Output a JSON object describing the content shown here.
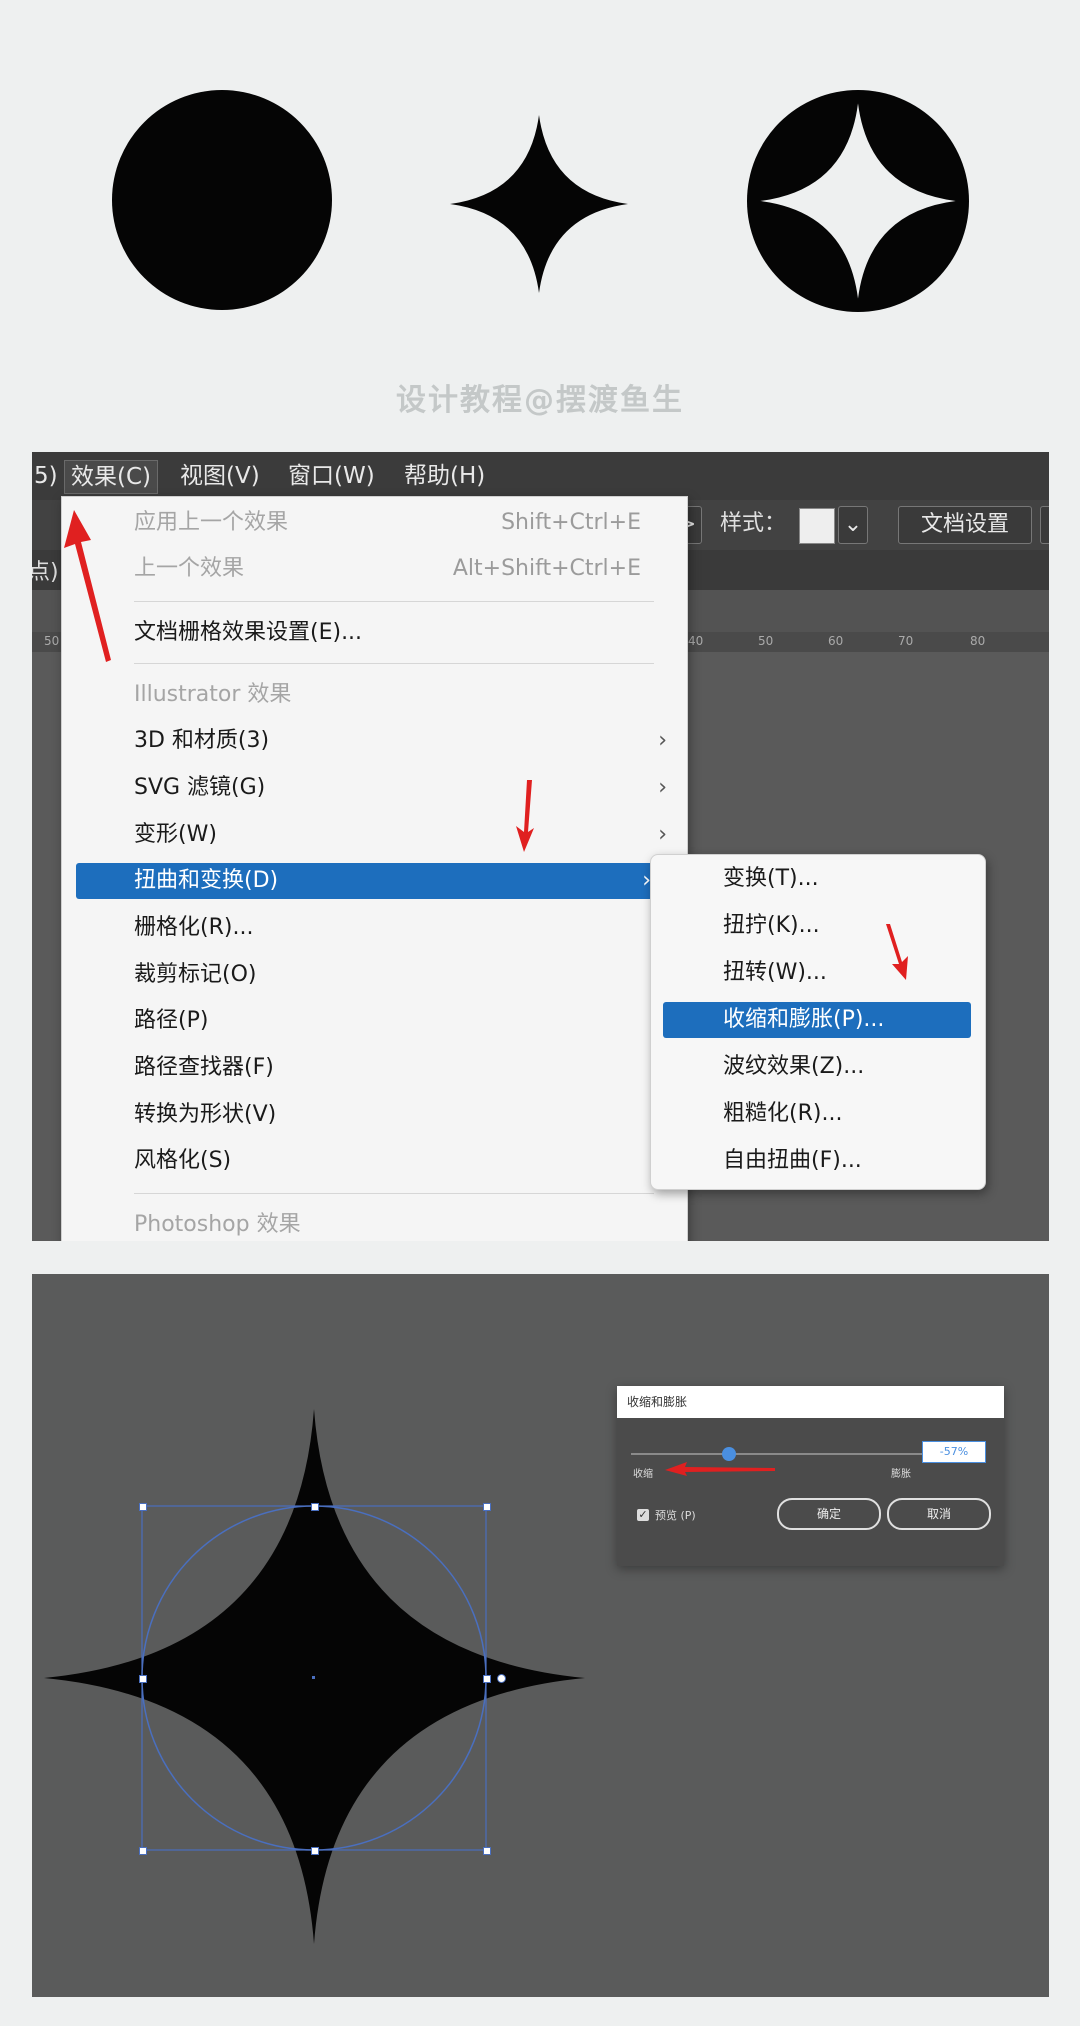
{
  "watermark": "设计教程@摆渡鱼生",
  "menubar": {
    "partial_left": "5)",
    "effect": "效果(C)",
    "view": "视图(V)",
    "window": "窗口(W)",
    "help": "帮助(H)"
  },
  "toolbar": {
    "arrow": ">",
    "style_label": "样式：",
    "chevron": "⌄",
    "doc_settings": "文档设置"
  },
  "tab_partial": "点)",
  "ruler_ticks": [
    "50",
    "40",
    "50",
    "60",
    "70",
    "80"
  ],
  "effect_menu": {
    "apply_last": "应用上一个效果",
    "apply_last_shortcut": "Shift+Ctrl+E",
    "last_effect": "上一个效果",
    "last_effect_shortcut": "Alt+Shift+Ctrl+E",
    "raster_settings": "文档栅格效果设置(E)...",
    "illustrator_header": "Illustrator 效果",
    "items": [
      {
        "label": "3D 和材质(3)",
        "arrow": "›"
      },
      {
        "label": "SVG 滤镜(G)",
        "arrow": "›"
      },
      {
        "label": "变形(W)",
        "arrow": "›"
      },
      {
        "label": "扭曲和变换(D)",
        "arrow": "›"
      },
      {
        "label": "栅格化(R)...",
        "arrow": ""
      },
      {
        "label": "裁剪标记(O)",
        "arrow": ""
      },
      {
        "label": "路径(P)",
        "arrow": "›"
      },
      {
        "label": "路径查找器(F)",
        "arrow": "›"
      },
      {
        "label": "转换为形状(V)",
        "arrow": "›"
      },
      {
        "label": "风格化(S)",
        "arrow": "›"
      }
    ],
    "photoshop_header": "Photoshop 效果"
  },
  "submenu": {
    "items": [
      "变换(T)...",
      "扭拧(K)...",
      "扭转(W)...",
      "收缩和膨胀(P)...",
      "波纹效果(Z)...",
      "粗糙化(R)...",
      "自由扭曲(F)..."
    ],
    "highlighted_index": 3
  },
  "dialog": {
    "title": "收缩和膨胀",
    "value": "-57%",
    "slider_fraction": 0.33,
    "shrink_label": "收缩",
    "expand_label": "膨胀",
    "preview_label": "预览 (P)",
    "check_mark": "✓",
    "ok_label": "确定",
    "cancel_label": "取消"
  },
  "colors": {
    "highlight": "#1d6ebd",
    "annotation_arrow": "#e02020",
    "selection": "#4a6fbf",
    "shape": "#050505"
  },
  "icons": [
    "red-arrow-icon",
    "checkbox-icon",
    "chevron-right-icon",
    "chevron-down-icon"
  ]
}
